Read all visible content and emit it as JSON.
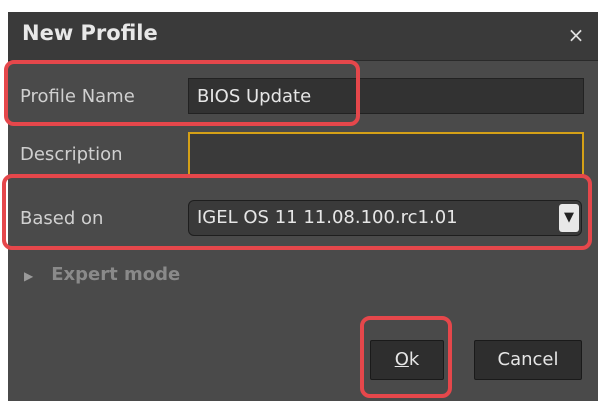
{
  "dialog": {
    "title": "New Profile",
    "close_glyph": "×"
  },
  "form": {
    "profile_name_label": "Profile Name",
    "profile_name_value": "BIOS Update",
    "description_label": "Description",
    "description_value": "",
    "based_on_label": "Based on",
    "based_on_value": "IGEL OS 11 11.08.100.rc1.01",
    "dropdown_icon": "chevron-down-icon"
  },
  "expert_mode": {
    "glyph": "▶",
    "label": "Expert mode"
  },
  "buttons": {
    "ok_mnemonic": "O",
    "ok_rest": "k",
    "cancel_label": "Cancel"
  },
  "colors": {
    "highlight": "#e5474b",
    "focus_border": "#d4a017",
    "dialog_bg": "#4a4a4a"
  }
}
